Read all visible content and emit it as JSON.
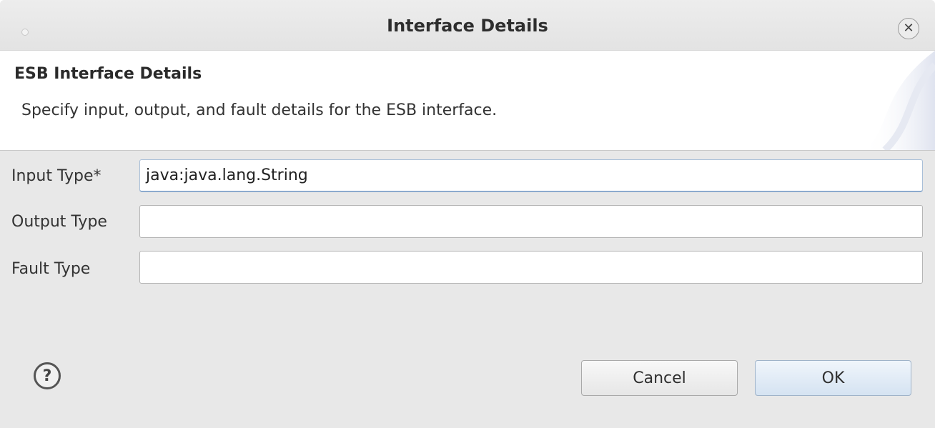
{
  "window": {
    "title": "Interface Details",
    "close_icon": "close-icon"
  },
  "banner": {
    "heading": "ESB Interface Details",
    "description": "Specify input, output, and fault details for the ESB interface."
  },
  "form": {
    "input_type": {
      "label": "Input Type*",
      "value": "java:java.lang.String"
    },
    "output_type": {
      "label": "Output Type",
      "value": ""
    },
    "fault_type": {
      "label": "Fault Type",
      "value": ""
    }
  },
  "footer": {
    "help_icon": "help-icon",
    "help_glyph": "?",
    "cancel_label": "Cancel",
    "ok_label": "OK"
  },
  "colors": {
    "dialog_bg": "#e8e8e8",
    "banner_bg": "#ffffff",
    "ok_button_tint": "#d5e3f2",
    "focus_accent": "#6e95c3"
  }
}
